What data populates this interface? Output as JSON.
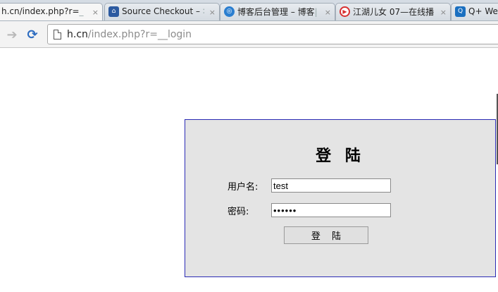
{
  "tabs": [
    {
      "title": "h.cn/index.php?r=",
      "fade": "_",
      "close": "×",
      "favicon": "none",
      "active": true
    },
    {
      "title": "Source Checkout – ",
      "fade": "∶",
      "close": "×",
      "favicon": "house-icon",
      "color": "#2c5aa0"
    },
    {
      "title": "博客后台管理 – 博客",
      "fade": "|",
      "close": "×",
      "favicon": "circle-logo-icon",
      "color": "#2a7ed0"
    },
    {
      "title": "江湖儿女 07—在线播",
      "fade": "",
      "close": "×",
      "favicon": "play-icon",
      "color": "#d83030"
    },
    {
      "title": "Q+ Web",
      "fade": "",
      "close": "",
      "favicon": "q-icon",
      "color": "#1a6fc0"
    }
  ],
  "toolbar": {
    "url_host": "h.cn",
    "url_path": "/index.php?r=__login"
  },
  "login": {
    "title": "登 陆",
    "username_label": "用户名:",
    "username_value": "test",
    "password_label": "密码:",
    "password_value": "••••••",
    "submit_label": "登 陆"
  },
  "colors": {
    "box_border": "#2b2bb5",
    "box_background": "#e4e4e4",
    "reload_accent": "#2d6cc0"
  }
}
